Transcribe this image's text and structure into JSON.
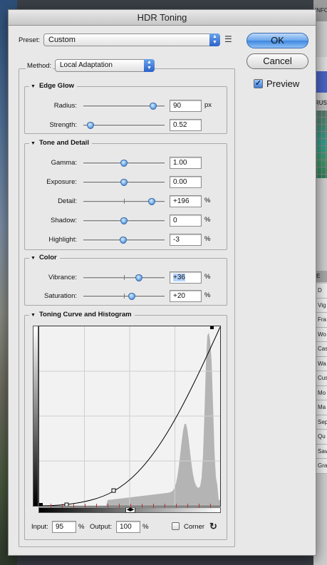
{
  "dialog": {
    "title": "HDR Toning"
  },
  "preset": {
    "label": "Preset:",
    "value": "Custom"
  },
  "buttons": {
    "ok": "OK",
    "cancel": "Cancel"
  },
  "preview": {
    "label": "Preview",
    "checked": true
  },
  "method": {
    "label": "Method:",
    "value": "Local Adaptation"
  },
  "edge_glow": {
    "title": "Edge Glow",
    "radius": {
      "label": "Radius:",
      "value": "90",
      "unit": "px",
      "position": 0.86
    },
    "strength": {
      "label": "Strength:",
      "value": "0.52",
      "unit": "",
      "position": 0.09
    }
  },
  "tone_detail": {
    "title": "Tone and Detail",
    "gamma": {
      "label": "Gamma:",
      "value": "1.00",
      "unit": "",
      "position": 0.5
    },
    "exposure": {
      "label": "Exposure:",
      "value": "0.00",
      "unit": "",
      "position": 0.5
    },
    "detail": {
      "label": "Detail:",
      "value": "+196",
      "unit": "%",
      "position": 0.84
    },
    "shadow": {
      "label": "Shadow:",
      "value": "0",
      "unit": "%",
      "position": 0.5
    },
    "highlight": {
      "label": "Highlight:",
      "value": "-3",
      "unit": "%",
      "position": 0.49
    }
  },
  "color": {
    "title": "Color",
    "vibrance": {
      "label": "Vibrance:",
      "value": "+36",
      "unit": "%",
      "position": 0.68
    },
    "saturation": {
      "label": "Saturation:",
      "value": "+20",
      "unit": "%",
      "position": 0.6
    }
  },
  "curve": {
    "title": "Toning Curve and Histogram",
    "input_label": "Input:",
    "input_value": "95",
    "input_unit": "%",
    "output_label": "Output:",
    "output_value": "100",
    "output_unit": "%",
    "corner_label": "Corner",
    "corner_checked": false
  },
  "background": {
    "top_label": "INFO",
    "swatch_label": "RUS",
    "list_header": "E",
    "list": [
      "D",
      "Vig",
      "Fra",
      "Wo",
      "Cas",
      "Wa",
      "Cus",
      "Mo",
      "Ma",
      "Sep",
      "Qu",
      "Sav",
      "Gra"
    ]
  },
  "colors": {
    "accent": "#3d86e0",
    "dialog_bg": "#e8e8e8"
  }
}
